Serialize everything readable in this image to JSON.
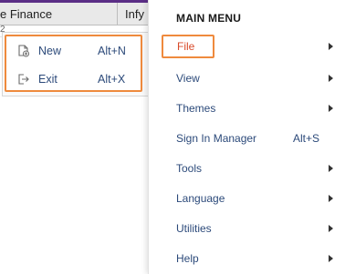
{
  "background": {
    "columns": [
      "e Finance",
      "Infy"
    ],
    "cell_fragment": "2"
  },
  "file_submenu": {
    "items": [
      {
        "label": "New",
        "shortcut": "Alt+N",
        "icon": "new-document-icon"
      },
      {
        "label": "Exit",
        "shortcut": "Alt+X",
        "icon": "exit-icon"
      }
    ]
  },
  "main_menu": {
    "title": "MAIN MENU",
    "items": [
      {
        "label": "File",
        "shortcut": "",
        "has_submenu": true,
        "highlighted": true
      },
      {
        "label": "View",
        "shortcut": "",
        "has_submenu": true
      },
      {
        "label": "Themes",
        "shortcut": "",
        "has_submenu": true
      },
      {
        "label": "Sign In Manager",
        "shortcut": "Alt+S",
        "has_submenu": false
      },
      {
        "label": "Tools",
        "shortcut": "",
        "has_submenu": true
      },
      {
        "label": "Language",
        "shortcut": "",
        "has_submenu": true
      },
      {
        "label": "Utilities",
        "shortcut": "",
        "has_submenu": true
      },
      {
        "label": "Help",
        "shortcut": "",
        "has_submenu": true
      }
    ]
  },
  "colors": {
    "accent_orange": "#ef8a3d",
    "menu_text": "#2c4a7a",
    "title_bar": "#5b2e86"
  }
}
